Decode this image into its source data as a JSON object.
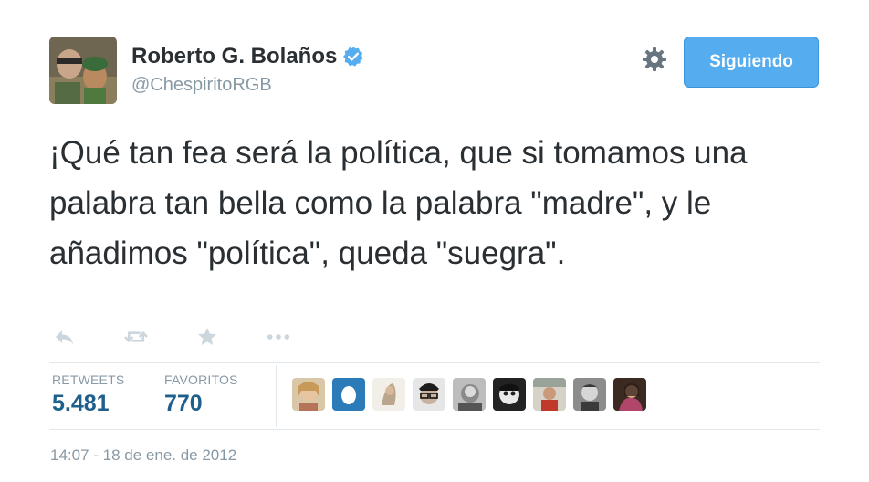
{
  "user": {
    "name": "Roberto G. Bolaños",
    "handle": "@ChespiritoRGB"
  },
  "follow_button_label": "Siguiendo",
  "tweet_text": "¡Qué tan fea será la política, que si tomamos una palabra tan bella como la palabra \"madre\", y le añadimos \"política\", queda \"suegra\".",
  "stats": {
    "retweets_label": "RETWEETS",
    "retweets_count": "5.481",
    "favorites_label": "FAVORITOS",
    "favorites_count": "770"
  },
  "timestamp": "14:07 - 18 de ene. de 2012",
  "colors": {
    "accent": "#55acee",
    "stat_count": "#1f5f8b",
    "muted": "#8899a6",
    "text": "#292f33"
  },
  "icons": {
    "action_bar": [
      "reply-icon",
      "retweet-icon",
      "favorite-star-icon",
      "more-icon"
    ],
    "header": [
      "gear-icon",
      "verified-badge-icon"
    ]
  }
}
